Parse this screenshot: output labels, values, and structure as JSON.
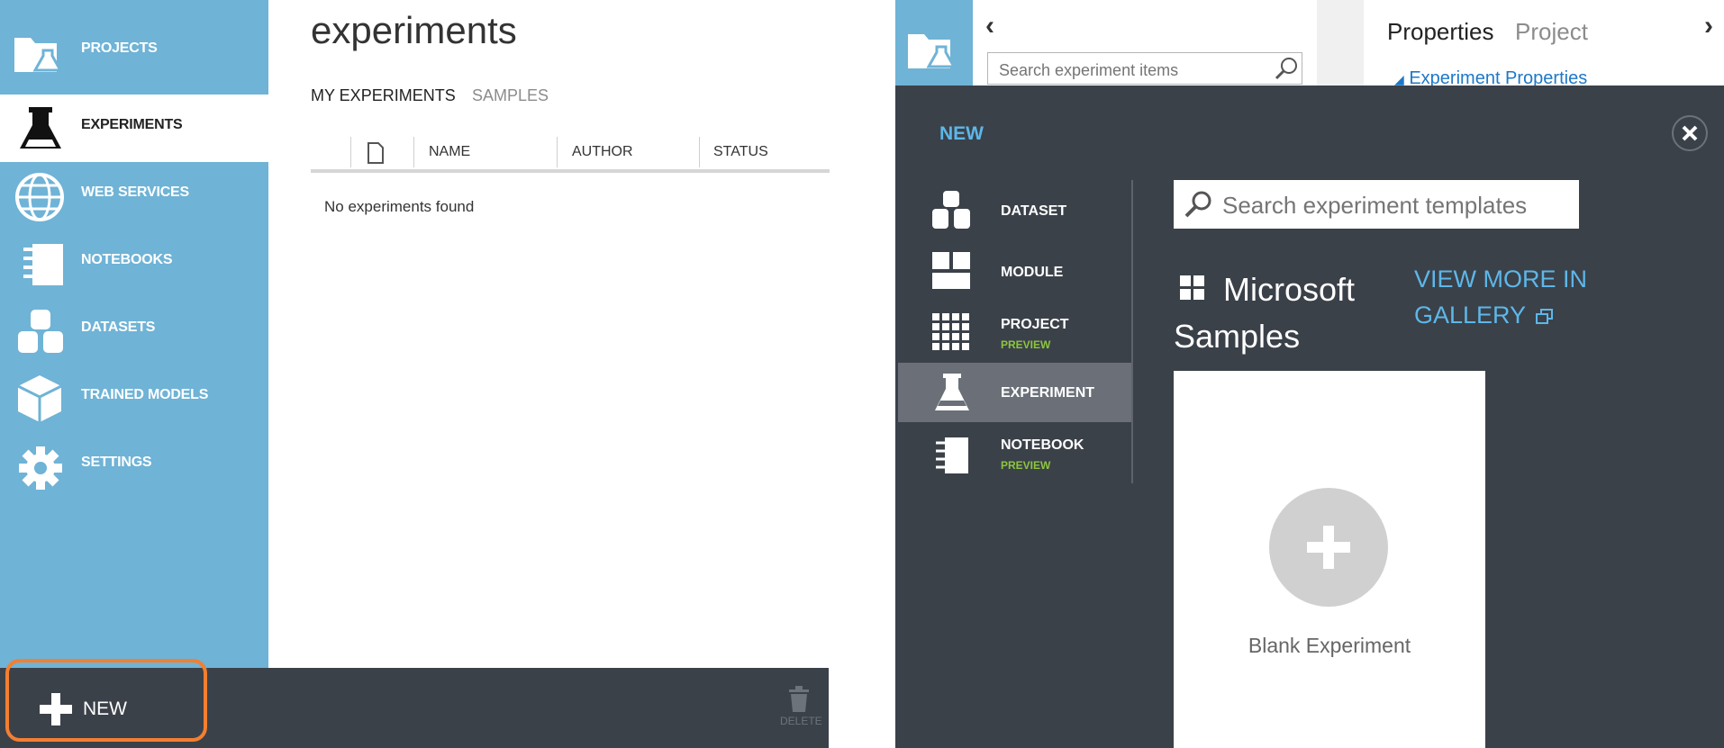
{
  "sidebar": {
    "items": [
      {
        "label": "PROJECTS",
        "icon": "projects-icon"
      },
      {
        "label": "EXPERIMENTS",
        "icon": "flask-icon"
      },
      {
        "label": "WEB SERVICES",
        "icon": "globe-icon"
      },
      {
        "label": "NOTEBOOKS",
        "icon": "notebook-icon"
      },
      {
        "label": "DATASETS",
        "icon": "datasets-icon"
      },
      {
        "label": "TRAINED MODELS",
        "icon": "cube-icon"
      },
      {
        "label": "SETTINGS",
        "icon": "gear-icon"
      }
    ],
    "active": "EXPERIMENTS"
  },
  "main": {
    "title": "experiments",
    "tabs": [
      {
        "label": "MY EXPERIMENTS",
        "active": true
      },
      {
        "label": "SAMPLES",
        "active": false
      }
    ],
    "table": {
      "columns": [
        "NAME",
        "AUTHOR",
        "STATUS"
      ],
      "empty_message": "No experiments found"
    }
  },
  "bottom_bar": {
    "new_label": "NEW",
    "delete_label": "DELETE"
  },
  "background_editor": {
    "search_placeholder": "Search experiment items",
    "tabs": [
      "Properties",
      "Project"
    ],
    "section": "Experiment Properties"
  },
  "new_dialog": {
    "title": "NEW",
    "items": [
      {
        "label": "DATASET",
        "icon": "dataset-icon",
        "badge": ""
      },
      {
        "label": "MODULE",
        "icon": "module-icon",
        "badge": ""
      },
      {
        "label": "PROJECT",
        "icon": "project-grid-icon",
        "badge": "PREVIEW"
      },
      {
        "label": "EXPERIMENT",
        "icon": "flask-icon",
        "badge": ""
      },
      {
        "label": "NOTEBOOK",
        "icon": "notebook-icon",
        "badge": "PREVIEW"
      }
    ],
    "selected": "EXPERIMENT",
    "search_placeholder": "Search experiment templates",
    "samples_title": "Microsoft Samples",
    "gallery_link": "VIEW MORE IN GALLERY",
    "blank_card_label": "Blank Experiment"
  },
  "colors": {
    "sidebar": "#6fb3d6",
    "dark": "#3b4149",
    "accent": "#5db7e9",
    "highlight": "#f37f31",
    "preview": "#8cc63f"
  }
}
